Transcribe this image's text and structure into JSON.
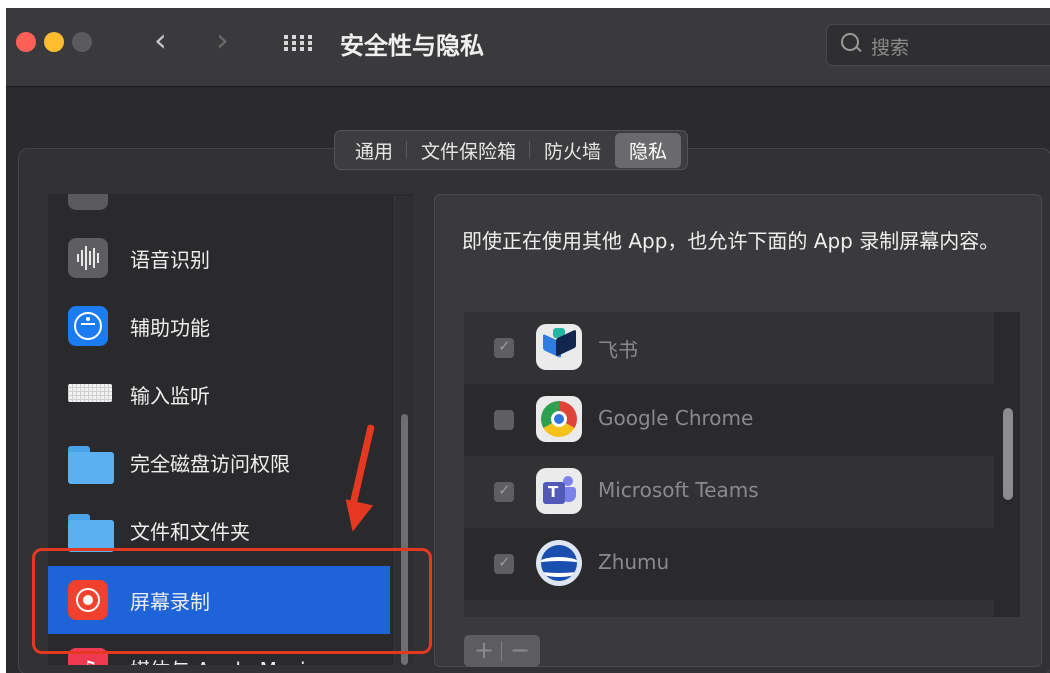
{
  "window": {
    "title": "安全性与隐私"
  },
  "toolbar": {
    "back_glyph": "‹",
    "forward_glyph": "›",
    "grid_icon": "grid-icon",
    "search_placeholder": "搜索"
  },
  "tabs": [
    {
      "label": "通用",
      "active": false
    },
    {
      "label": "文件保险箱",
      "active": false
    },
    {
      "label": "防火墙",
      "active": false
    },
    {
      "label": "隐私",
      "active": true
    }
  ],
  "sidebar": {
    "items": [
      {
        "label": "语音识别",
        "icon": "waveform-icon",
        "selected": false
      },
      {
        "label": "辅助功能",
        "icon": "accessibility-icon",
        "selected": false
      },
      {
        "label": "输入监听",
        "icon": "keyboard-icon",
        "selected": false
      },
      {
        "label": "完全磁盘访问权限",
        "icon": "folder-icon",
        "selected": false
      },
      {
        "label": "文件和文件夹",
        "icon": "folder-icon",
        "selected": false
      },
      {
        "label": "屏幕录制",
        "icon": "screen-record-icon",
        "selected": true
      },
      {
        "label": "媒体与 Apple Music",
        "icon": "music-icon",
        "selected": false
      }
    ]
  },
  "detail": {
    "description": "即使正在使用其他 App，也允许下面的 App 录制屏幕内容。",
    "apps": [
      {
        "name": "飞书",
        "icon": "feishu-icon",
        "checked": true
      },
      {
        "name": "Google Chrome",
        "icon": "chrome-icon",
        "checked": false
      },
      {
        "name": "Microsoft Teams",
        "icon": "teams-icon",
        "checked": true
      },
      {
        "name": "Zhumu",
        "icon": "zhumu-icon",
        "checked": true
      }
    ],
    "add_label": "+",
    "remove_label": "−"
  },
  "colors": {
    "selection": "#1f63d9",
    "annotation": "#e53820",
    "close": "#fe5f57",
    "minimize": "#febc2e"
  }
}
